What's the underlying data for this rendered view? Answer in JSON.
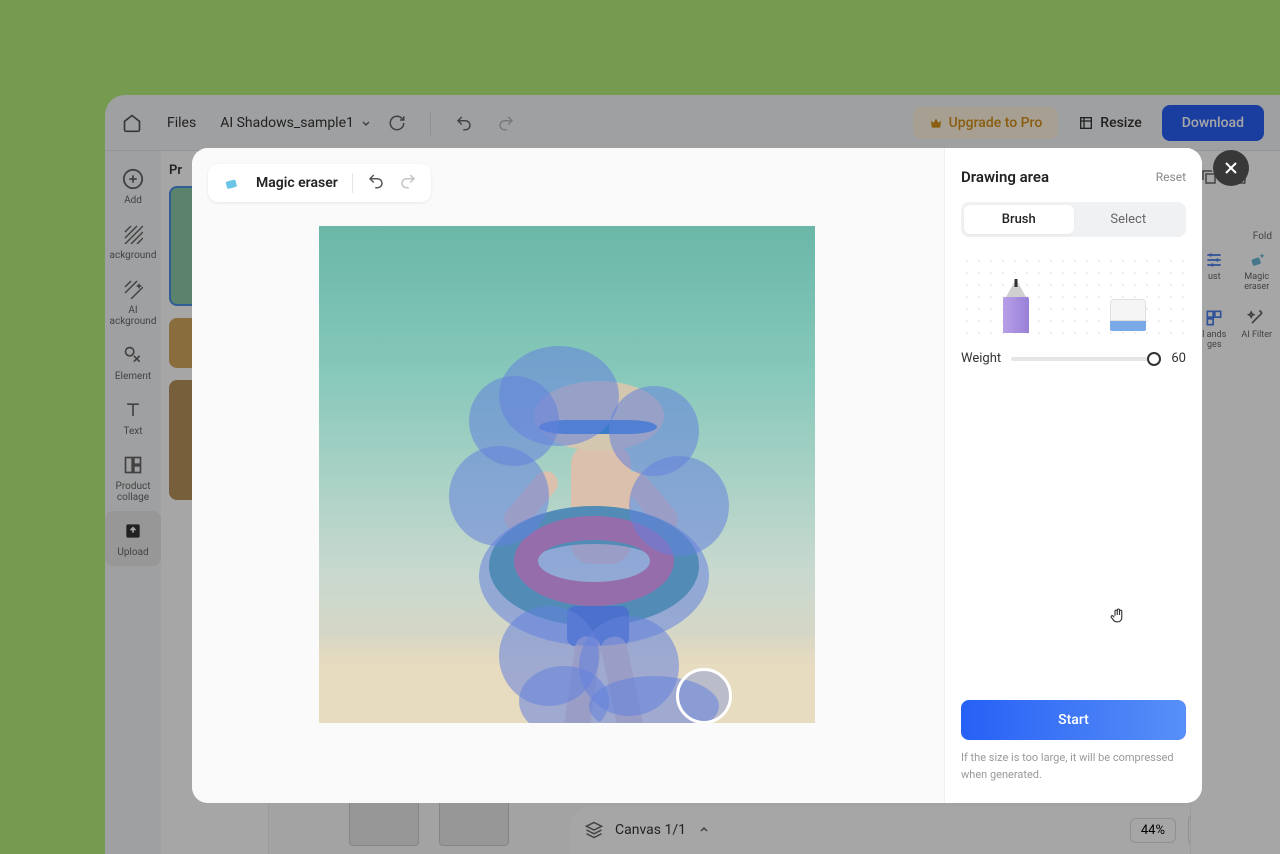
{
  "toolbar": {
    "files_label": "Files",
    "filename": "AI Shadows_sample1",
    "upgrade_label": "Upgrade to Pro",
    "resize_label": "Resize",
    "download_label": "Download"
  },
  "sidebar": {
    "items": [
      {
        "label": "Add"
      },
      {
        "label": "ackground"
      },
      {
        "label": "AI ackground"
      },
      {
        "label": "Element"
      },
      {
        "label": "Text"
      },
      {
        "label": "Product collage"
      },
      {
        "label": "Upload"
      }
    ]
  },
  "panel": {
    "header": "Pr"
  },
  "right_tools": {
    "fold_label": "Fold",
    "adjust_label": "ust",
    "magic_eraser_label": "Magic eraser",
    "ands_label": "l ands ges",
    "ai_filter_label": "AI Filter"
  },
  "canvas_bar": {
    "canvas_label": "Canvas 1/1",
    "zoom": "44%",
    "help": "?"
  },
  "modal": {
    "title": "Magic eraser",
    "drawing_area": "Drawing area",
    "reset": "Reset",
    "brush": "Brush",
    "select": "Select",
    "weight_label": "Weight",
    "weight_value": "60",
    "start": "Start",
    "help_text": "If the size is too large, it will be compressed when generated."
  }
}
